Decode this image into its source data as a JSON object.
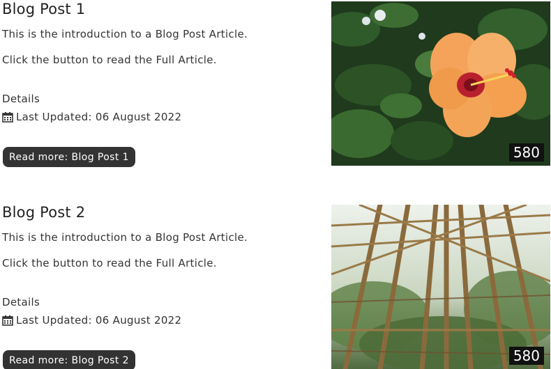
{
  "posts": [
    {
      "title": "Blog Post 1",
      "intro": "This is the introduction to a Blog Post Article.",
      "cta_text": "Click the button to read the Full Article.",
      "details_label": "Details",
      "updated": "Last Updated: 06 August 2022",
      "button_label": "Read more: Blog Post 1",
      "image_badge": "580",
      "image_icon": "hibiscus-flower-photo"
    },
    {
      "title": "Blog Post 2",
      "intro": "This is the introduction to a Blog Post Article.",
      "cta_text": "Click the button to read the Full Article.",
      "details_label": "Details",
      "updated": "Last Updated: 06 August 2022",
      "button_label": "Read more: Blog Post 2",
      "image_badge": "580",
      "image_icon": "bamboo-greenhouse-photo"
    }
  ],
  "icons": {
    "calendar": "calendar-icon"
  },
  "colors": {
    "button_bg": "#333333",
    "button_text": "#ffffff",
    "text": "#333333",
    "badge_bg": "#111111"
  }
}
